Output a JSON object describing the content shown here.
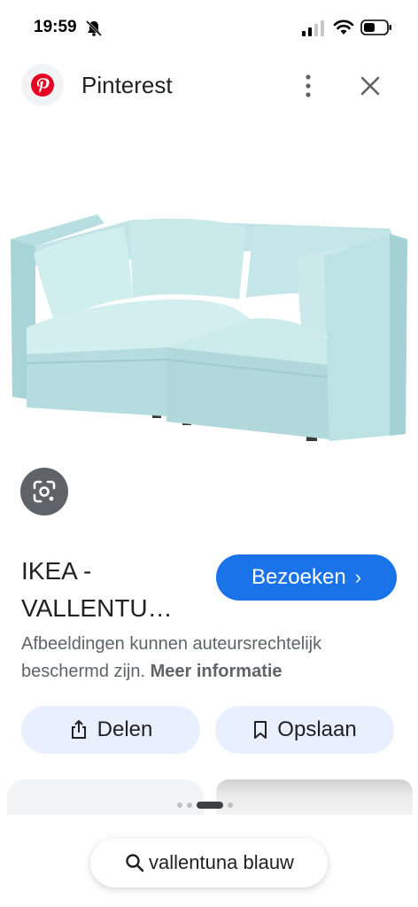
{
  "status_bar": {
    "time": "19:59"
  },
  "header": {
    "app_name": "Pinterest"
  },
  "result": {
    "title_line1": "IKEA -",
    "title_line2": "VALLENTU…",
    "visit_label": "Bezoeken",
    "visit_chevron": "›"
  },
  "notice": {
    "text": "Afbeeldingen kunnen auteursrechtelijk beschermd zijn.",
    "link": "Meer informatie"
  },
  "actions": {
    "share_label": "Delen",
    "save_label": "Opslaan"
  },
  "pagination": {
    "total": 4,
    "active_index": 2
  },
  "search_chip": {
    "query": "vallentuna blauw"
  },
  "colors": {
    "accent": "#1a73e8",
    "chip_bg": "#e8f0fe",
    "pinterest_red": "#e60023",
    "sofa": "#bfe4e6"
  }
}
